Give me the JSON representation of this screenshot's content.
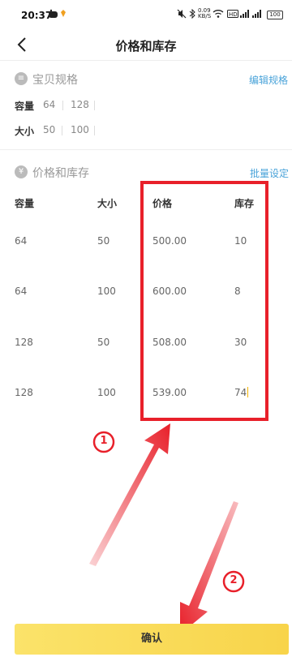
{
  "status_bar": {
    "time": "20:37",
    "net_speed": "0.09\nKB/S",
    "battery": "100"
  },
  "header": {
    "title": "价格和库存"
  },
  "spec_section": {
    "title": "宝贝规格",
    "edit_link": "编辑规格",
    "rows": [
      {
        "label": "容量",
        "values": [
          "64",
          "128"
        ]
      },
      {
        "label": "大小",
        "values": [
          "50",
          "100"
        ]
      }
    ]
  },
  "price_section": {
    "title": "价格和库存",
    "batch_link": "批量设定",
    "columns": [
      "容量",
      "大小",
      "价格",
      "库存"
    ],
    "rows": [
      [
        "64",
        "50",
        "500.00",
        "10"
      ],
      [
        "64",
        "100",
        "600.00",
        "8"
      ],
      [
        "128",
        "50",
        "508.00",
        "30"
      ],
      [
        "128",
        "100",
        "539.00",
        "74"
      ]
    ]
  },
  "annotations": {
    "marker_1": "1",
    "marker_2": "2",
    "highlight_color": "#e8202a"
  },
  "footer": {
    "confirm_label": "确认"
  }
}
